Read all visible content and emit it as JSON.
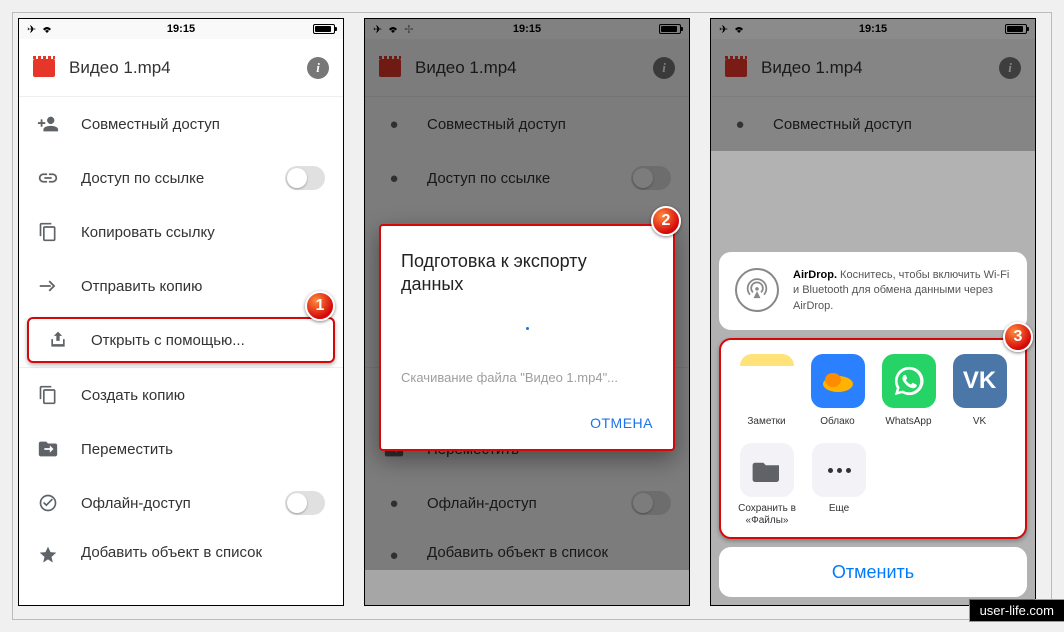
{
  "status": {
    "time": "19:15"
  },
  "header": {
    "title": "Видео 1.mp4"
  },
  "menu": {
    "share": "Совместный доступ",
    "link_access": "Доступ по ссылке",
    "copy_link": "Копировать ссылку",
    "send_copy": "Отправить копию",
    "open_with": "Открыть с помощью...",
    "make_copy": "Создать копию",
    "move": "Переместить",
    "offline": "Офлайн-доступ",
    "add_to_list": "Добавить объект в список"
  },
  "dialog": {
    "title": "Подготовка к экспорту данных",
    "message": "Скачивание файла \"Видео 1.mp4\"...",
    "cancel": "ОТМЕНА"
  },
  "share_sheet": {
    "airdrop_label": "AirDrop.",
    "airdrop_text": " Коснитесь, чтобы включить Wi-Fi и Bluetooth для обмена данными через AirDrop.",
    "apps": {
      "notes": "Заметки",
      "cloud": "Облако",
      "whatsapp": "WhatsApp",
      "vk": "VK"
    },
    "actions": {
      "files": "Сохранить в «Файлы»",
      "more": "Еще"
    },
    "cancel": "Отменить"
  },
  "badges": {
    "b1": "1",
    "b2": "2",
    "b3": "3"
  },
  "watermark": "user-life.com"
}
